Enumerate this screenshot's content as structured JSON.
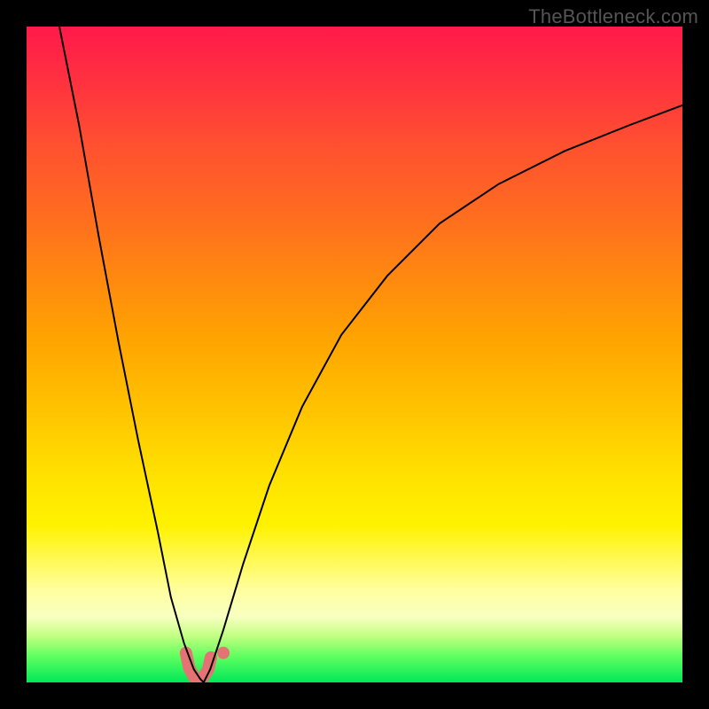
{
  "watermark": {
    "text": "TheBottleneck.com"
  },
  "colors": {
    "frame": "#000000",
    "curve": "#000000",
    "highlight": "#e57373",
    "gradient_top": "#ff1a4a",
    "gradient_bottom": "#00e858"
  },
  "chart_data": {
    "type": "line",
    "title": "",
    "xlabel": "",
    "ylabel": "",
    "xlim": [
      0,
      100
    ],
    "ylim": [
      0,
      100
    ],
    "series": [
      {
        "name": "left-curve",
        "x": [
          5,
          8,
          11,
          14,
          17,
          20,
          22,
          24,
          25.5,
          26.5,
          27
        ],
        "y": [
          100,
          85,
          68,
          52,
          37,
          23,
          13,
          6,
          2,
          0.5,
          0
        ]
      },
      {
        "name": "right-curve",
        "x": [
          27,
          28,
          30,
          33,
          37,
          42,
          48,
          55,
          63,
          72,
          82,
          92,
          100
        ],
        "y": [
          0,
          2,
          8,
          18,
          30,
          42,
          53,
          62,
          70,
          76,
          81,
          85,
          88
        ]
      }
    ],
    "highlight": {
      "name": "optimal-region",
      "x": [
        24.3,
        24.8,
        25.5,
        26.3,
        27.0,
        27.7,
        28.1
      ],
      "y": [
        4.5,
        2.2,
        0.9,
        0.5,
        0.9,
        2.0,
        3.8
      ]
    },
    "highlight_dot": {
      "x": 30.0,
      "y": 4.5
    },
    "background": "heat-gradient-red-to-green"
  }
}
